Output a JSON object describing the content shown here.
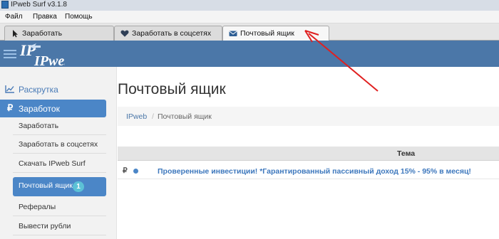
{
  "window": {
    "title": "IPweb Surf v3.1.8"
  },
  "menu": {
    "items": [
      "Файл",
      "Правка",
      "Помощь"
    ]
  },
  "tabs": [
    {
      "label": "Заработать",
      "icon": "cursor-icon"
    },
    {
      "label": "Заработать в соцсетях",
      "icon": "heart-icon"
    },
    {
      "label": "Почтовый ящик",
      "icon": "envelope-icon",
      "active": true
    }
  ],
  "logo": {
    "text": "IPweb"
  },
  "sidebar": {
    "top_item": "Раскрутка",
    "active_section": "Заработок",
    "items": [
      {
        "label": "Заработать"
      },
      {
        "label": "Заработать в соцсетях"
      },
      {
        "label": "Скачать IPweb Surf"
      },
      {
        "label": "Почтовый ящик",
        "badge": "1",
        "active": true
      },
      {
        "label": "Рефералы"
      },
      {
        "label": "Вывести рубли"
      }
    ]
  },
  "main": {
    "title": "Почтовый ящик",
    "breadcrumb": [
      "IPweb",
      "Почтовый ящик"
    ],
    "breadcrumb_sep": "/",
    "table": {
      "header": "Тема",
      "rows": [
        {
          "currency": "₽",
          "subject": "Проверенные инвестиции! *Гарантированный пассивный доход 15% - 95% в месяц!"
        }
      ]
    }
  },
  "colors": {
    "header_bg": "#4b77a8",
    "active_bg": "#4b86c7",
    "link": "#3e78bd",
    "badge": "#5cc1d6",
    "annotation_arrow": "#e02020"
  }
}
